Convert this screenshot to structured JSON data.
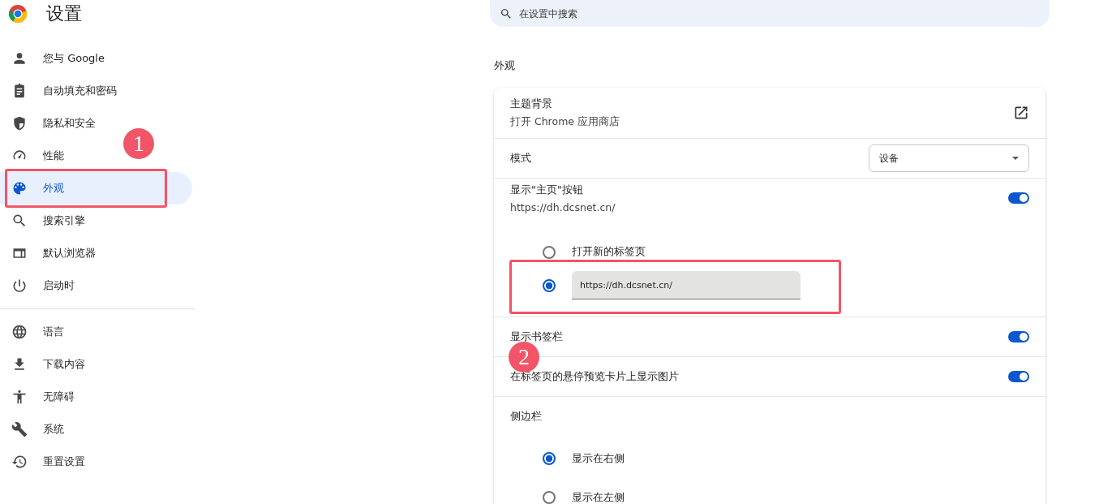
{
  "header": {
    "title": "设置"
  },
  "search": {
    "placeholder": "在设置中搜索"
  },
  "sidebar": {
    "groups": [
      [
        {
          "label": "您与 Google",
          "selected": false
        },
        {
          "label": "自动填充和密码",
          "selected": false
        },
        {
          "label": "隐私和安全",
          "selected": false
        },
        {
          "label": "性能",
          "selected": false
        },
        {
          "label": "外观",
          "selected": true
        },
        {
          "label": "搜索引擎",
          "selected": false
        },
        {
          "label": "默认浏览器",
          "selected": false
        },
        {
          "label": "启动时",
          "selected": false
        }
      ],
      [
        {
          "label": "语言",
          "selected": false
        },
        {
          "label": "下载内容",
          "selected": false
        },
        {
          "label": "无障碍",
          "selected": false
        },
        {
          "label": "系统",
          "selected": false
        },
        {
          "label": "重置设置",
          "selected": false
        }
      ]
    ]
  },
  "section": {
    "title": "外观"
  },
  "settings": [
    {
      "kind": "link",
      "title": "主题背景",
      "subtitle": "打开 Chrome 应用商店"
    },
    {
      "kind": "select",
      "title": "模式",
      "value": "设备"
    },
    {
      "kind": "toggle",
      "title": "显示\"主页\"按钮",
      "subtitle": "https://dh.dcsnet.cn/",
      "on": true,
      "options": [
        {
          "kind": "label",
          "label": "打开新的标签页",
          "selected": false
        },
        {
          "kind": "input",
          "value": "https://dh.dcsnet.cn/",
          "selected": true
        }
      ]
    },
    {
      "kind": "toggle",
      "title": "显示书签栏",
      "on": true
    },
    {
      "kind": "toggle",
      "title": "在标签页的悬停预览卡片上显示图片",
      "on": true
    },
    {
      "kind": "radios",
      "title": "侧边栏",
      "options": [
        {
          "kind": "label",
          "label": "显示在右侧",
          "selected": true
        },
        {
          "kind": "label",
          "label": "显示在左侧",
          "selected": false
        }
      ]
    }
  ],
  "annotations": [
    {
      "label": "1"
    },
    {
      "label": "2"
    }
  ]
}
